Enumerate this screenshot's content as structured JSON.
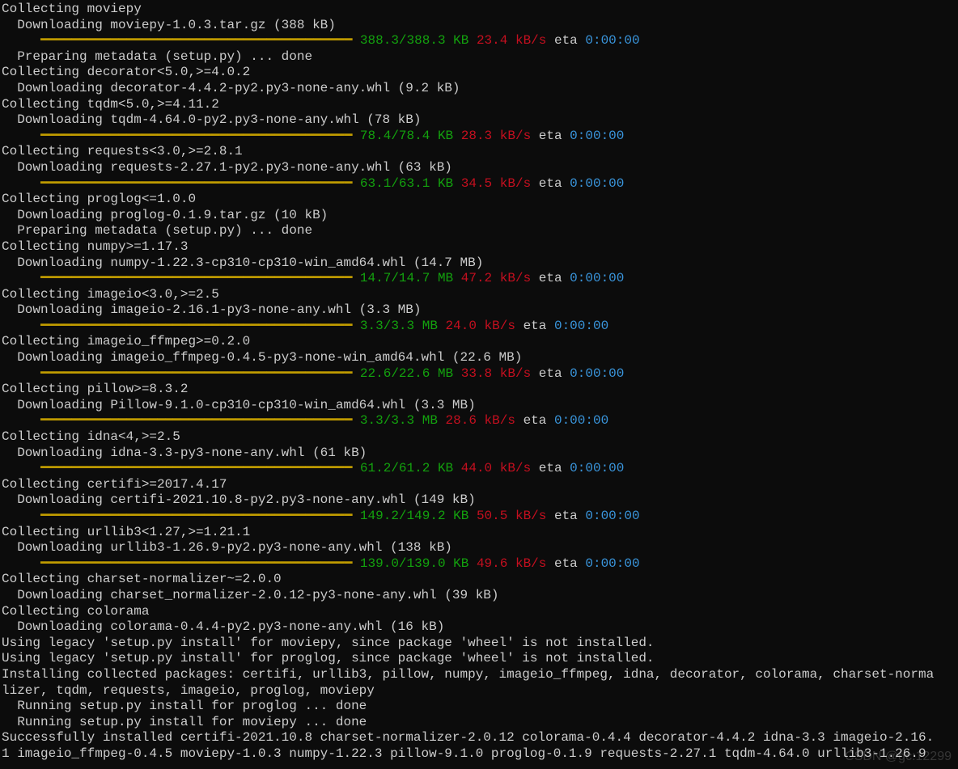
{
  "lines": [
    [
      {
        "c": "w",
        "t": "Collecting moviepy"
      }
    ],
    [
      {
        "c": "w",
        "t": "  Downloading moviepy-1.0.3.tar.gz (388 kB)"
      }
    ],
    [
      {
        "c": "y",
        "t": "     ━━━━━━━━━━━━━━━━━━━━━━━━━━━━━━━━━━━━━━━━ "
      },
      {
        "c": "g",
        "t": "388.3/388.3 KB "
      },
      {
        "c": "r",
        "t": "23.4 kB/s "
      },
      {
        "c": "w",
        "t": "eta "
      },
      {
        "c": "c",
        "t": "0:00:00"
      }
    ],
    [
      {
        "c": "w",
        "t": "  Preparing metadata (setup.py) ... done"
      }
    ],
    [
      {
        "c": "w",
        "t": "Collecting decorator<5.0,>=4.0.2"
      }
    ],
    [
      {
        "c": "w",
        "t": "  Downloading decorator-4.4.2-py2.py3-none-any.whl (9.2 kB)"
      }
    ],
    [
      {
        "c": "w",
        "t": "Collecting tqdm<5.0,>=4.11.2"
      }
    ],
    [
      {
        "c": "w",
        "t": "  Downloading tqdm-4.64.0-py2.py3-none-any.whl (78 kB)"
      }
    ],
    [
      {
        "c": "y",
        "t": "     ━━━━━━━━━━━━━━━━━━━━━━━━━━━━━━━━━━━━━━━━ "
      },
      {
        "c": "g",
        "t": "78.4/78.4 KB "
      },
      {
        "c": "r",
        "t": "28.3 kB/s "
      },
      {
        "c": "w",
        "t": "eta "
      },
      {
        "c": "c",
        "t": "0:00:00"
      }
    ],
    [
      {
        "c": "w",
        "t": "Collecting requests<3.0,>=2.8.1"
      }
    ],
    [
      {
        "c": "w",
        "t": "  Downloading requests-2.27.1-py2.py3-none-any.whl (63 kB)"
      }
    ],
    [
      {
        "c": "y",
        "t": "     ━━━━━━━━━━━━━━━━━━━━━━━━━━━━━━━━━━━━━━━━ "
      },
      {
        "c": "g",
        "t": "63.1/63.1 KB "
      },
      {
        "c": "r",
        "t": "34.5 kB/s "
      },
      {
        "c": "w",
        "t": "eta "
      },
      {
        "c": "c",
        "t": "0:00:00"
      }
    ],
    [
      {
        "c": "w",
        "t": "Collecting proglog<=1.0.0"
      }
    ],
    [
      {
        "c": "w",
        "t": "  Downloading proglog-0.1.9.tar.gz (10 kB)"
      }
    ],
    [
      {
        "c": "w",
        "t": "  Preparing metadata (setup.py) ... done"
      }
    ],
    [
      {
        "c": "w",
        "t": "Collecting numpy>=1.17.3"
      }
    ],
    [
      {
        "c": "w",
        "t": "  Downloading numpy-1.22.3-cp310-cp310-win_amd64.whl (14.7 MB)"
      }
    ],
    [
      {
        "c": "y",
        "t": "     ━━━━━━━━━━━━━━━━━━━━━━━━━━━━━━━━━━━━━━━━ "
      },
      {
        "c": "g",
        "t": "14.7/14.7 MB "
      },
      {
        "c": "r",
        "t": "47.2 kB/s "
      },
      {
        "c": "w",
        "t": "eta "
      },
      {
        "c": "c",
        "t": "0:00:00"
      }
    ],
    [
      {
        "c": "w",
        "t": "Collecting imageio<3.0,>=2.5"
      }
    ],
    [
      {
        "c": "w",
        "t": "  Downloading imageio-2.16.1-py3-none-any.whl (3.3 MB)"
      }
    ],
    [
      {
        "c": "y",
        "t": "     ━━━━━━━━━━━━━━━━━━━━━━━━━━━━━━━━━━━━━━━━ "
      },
      {
        "c": "g",
        "t": "3.3/3.3 MB "
      },
      {
        "c": "r",
        "t": "24.0 kB/s "
      },
      {
        "c": "w",
        "t": "eta "
      },
      {
        "c": "c",
        "t": "0:00:00"
      }
    ],
    [
      {
        "c": "w",
        "t": "Collecting imageio_ffmpeg>=0.2.0"
      }
    ],
    [
      {
        "c": "w",
        "t": "  Downloading imageio_ffmpeg-0.4.5-py3-none-win_amd64.whl (22.6 MB)"
      }
    ],
    [
      {
        "c": "y",
        "t": "     ━━━━━━━━━━━━━━━━━━━━━━━━━━━━━━━━━━━━━━━━ "
      },
      {
        "c": "g",
        "t": "22.6/22.6 MB "
      },
      {
        "c": "r",
        "t": "33.8 kB/s "
      },
      {
        "c": "w",
        "t": "eta "
      },
      {
        "c": "c",
        "t": "0:00:00"
      }
    ],
    [
      {
        "c": "w",
        "t": "Collecting pillow>=8.3.2"
      }
    ],
    [
      {
        "c": "w",
        "t": "  Downloading Pillow-9.1.0-cp310-cp310-win_amd64.whl (3.3 MB)"
      }
    ],
    [
      {
        "c": "y",
        "t": "     ━━━━━━━━━━━━━━━━━━━━━━━━━━━━━━━━━━━━━━━━ "
      },
      {
        "c": "g",
        "t": "3.3/3.3 MB "
      },
      {
        "c": "r",
        "t": "28.6 kB/s "
      },
      {
        "c": "w",
        "t": "eta "
      },
      {
        "c": "c",
        "t": "0:00:00"
      }
    ],
    [
      {
        "c": "w",
        "t": "Collecting idna<4,>=2.5"
      }
    ],
    [
      {
        "c": "w",
        "t": "  Downloading idna-3.3-py3-none-any.whl (61 kB)"
      }
    ],
    [
      {
        "c": "y",
        "t": "     ━━━━━━━━━━━━━━━━━━━━━━━━━━━━━━━━━━━━━━━━ "
      },
      {
        "c": "g",
        "t": "61.2/61.2 KB "
      },
      {
        "c": "r",
        "t": "44.0 kB/s "
      },
      {
        "c": "w",
        "t": "eta "
      },
      {
        "c": "c",
        "t": "0:00:00"
      }
    ],
    [
      {
        "c": "w",
        "t": "Collecting certifi>=2017.4.17"
      }
    ],
    [
      {
        "c": "w",
        "t": "  Downloading certifi-2021.10.8-py2.py3-none-any.whl (149 kB)"
      }
    ],
    [
      {
        "c": "y",
        "t": "     ━━━━━━━━━━━━━━━━━━━━━━━━━━━━━━━━━━━━━━━━ "
      },
      {
        "c": "g",
        "t": "149.2/149.2 KB "
      },
      {
        "c": "r",
        "t": "50.5 kB/s "
      },
      {
        "c": "w",
        "t": "eta "
      },
      {
        "c": "c",
        "t": "0:00:00"
      }
    ],
    [
      {
        "c": "w",
        "t": "Collecting urllib3<1.27,>=1.21.1"
      }
    ],
    [
      {
        "c": "w",
        "t": "  Downloading urllib3-1.26.9-py2.py3-none-any.whl (138 kB)"
      }
    ],
    [
      {
        "c": "y",
        "t": "     ━━━━━━━━━━━━━━━━━━━━━━━━━━━━━━━━━━━━━━━━ "
      },
      {
        "c": "g",
        "t": "139.0/139.0 KB "
      },
      {
        "c": "r",
        "t": "49.6 kB/s "
      },
      {
        "c": "w",
        "t": "eta "
      },
      {
        "c": "c",
        "t": "0:00:00"
      }
    ],
    [
      {
        "c": "w",
        "t": "Collecting charset-normalizer~=2.0.0"
      }
    ],
    [
      {
        "c": "w",
        "t": "  Downloading charset_normalizer-2.0.12-py3-none-any.whl (39 kB)"
      }
    ],
    [
      {
        "c": "w",
        "t": "Collecting colorama"
      }
    ],
    [
      {
        "c": "w",
        "t": "  Downloading colorama-0.4.4-py2.py3-none-any.whl (16 kB)"
      }
    ],
    [
      {
        "c": "w",
        "t": "Using legacy 'setup.py install' for moviepy, since package 'wheel' is not installed."
      }
    ],
    [
      {
        "c": "w",
        "t": "Using legacy 'setup.py install' for proglog, since package 'wheel' is not installed."
      }
    ],
    [
      {
        "c": "w",
        "t": "Installing collected packages: certifi, urllib3, pillow, numpy, imageio_ffmpeg, idna, decorator, colorama, charset-norma"
      }
    ],
    [
      {
        "c": "w",
        "t": "lizer, tqdm, requests, imageio, proglog, moviepy"
      }
    ],
    [
      {
        "c": "w",
        "t": "  Running setup.py install for proglog ... done"
      }
    ],
    [
      {
        "c": "w",
        "t": "  Running setup.py install for moviepy ... done"
      }
    ],
    [
      {
        "c": "w",
        "t": "Successfully installed certifi-2021.10.8 charset-normalizer-2.0.12 colorama-0.4.4 decorator-4.4.2 idna-3.3 imageio-2.16."
      }
    ],
    [
      {
        "c": "w",
        "t": "1 imageio_ffmpeg-0.4.5 moviepy-1.0.3 numpy-1.22.3 pillow-9.1.0 proglog-0.1.9 requests-2.27.1 tqdm-4.64.0 urllib3-1.26.9"
      }
    ]
  ],
  "watermark": "CSDN @gc:12299"
}
